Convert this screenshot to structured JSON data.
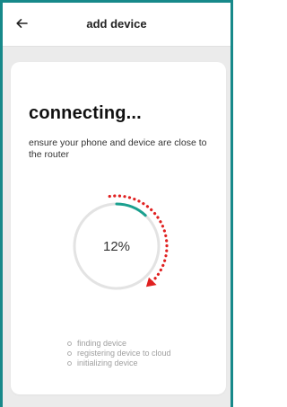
{
  "header": {
    "title": "add device",
    "back_icon": "arrow-left-icon"
  },
  "card": {
    "title": "connecting...",
    "description": "ensure your phone and device are close to the router"
  },
  "progress": {
    "percent_label": "12%",
    "value": 0.12,
    "track_color": "#e3e3e3",
    "fill_color": "#1aa08f",
    "arrow_color": "#e02020"
  },
  "steps": [
    {
      "label": "finding device"
    },
    {
      "label": "registering device to cloud"
    },
    {
      "label": "initializing device"
    }
  ],
  "colors": {
    "frame": "#17898a",
    "background": "#ebebeb"
  }
}
